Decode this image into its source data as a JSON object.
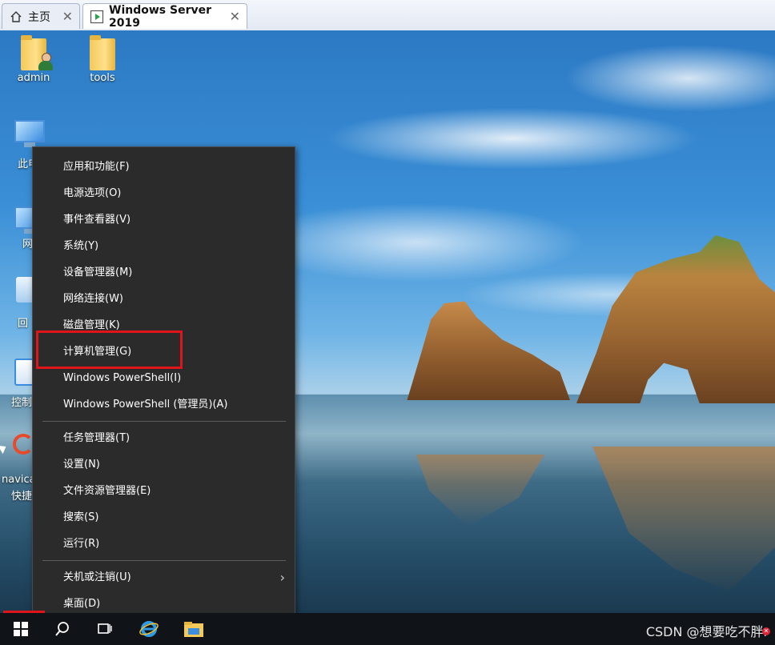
{
  "tabs": {
    "home_label": "主页",
    "active_label": "Windows Server 2019",
    "close_symbol": "✕"
  },
  "desktop_icons": {
    "admin": "admin",
    "tools": "tools",
    "partial_1": "此电",
    "partial_2": "网",
    "partial_3": "回",
    "partial_4": "控制",
    "partial_5a": "navica",
    "partial_5b": "快捷"
  },
  "menu": {
    "items": [
      {
        "label": "应用和功能(F)"
      },
      {
        "label": "电源选项(O)"
      },
      {
        "label": "事件查看器(V)"
      },
      {
        "label": "系统(Y)"
      },
      {
        "label": "设备管理器(M)"
      },
      {
        "label": "网络连接(W)"
      },
      {
        "label": "磁盘管理(K)"
      },
      {
        "label": "计算机管理(G)"
      },
      {
        "label": "Windows PowerShell(I)"
      },
      {
        "label": "Windows PowerShell (管理员)(A)"
      },
      {
        "label": "任务管理器(T)"
      },
      {
        "label": "设置(N)"
      },
      {
        "label": "文件资源管理器(E)"
      },
      {
        "label": "搜索(S)"
      },
      {
        "label": "运行(R)"
      },
      {
        "label": "关机或注销(U)"
      },
      {
        "label": "桌面(D)"
      }
    ],
    "submenu_arrow": "›",
    "highlight_color": "#e0151c"
  },
  "taskbar": {
    "watermark": "CSDN @想要吃不胖ı",
    "icons": [
      "start-icon",
      "search-icon",
      "task-view-icon",
      "ie-icon",
      "file-explorer-icon"
    ]
  }
}
